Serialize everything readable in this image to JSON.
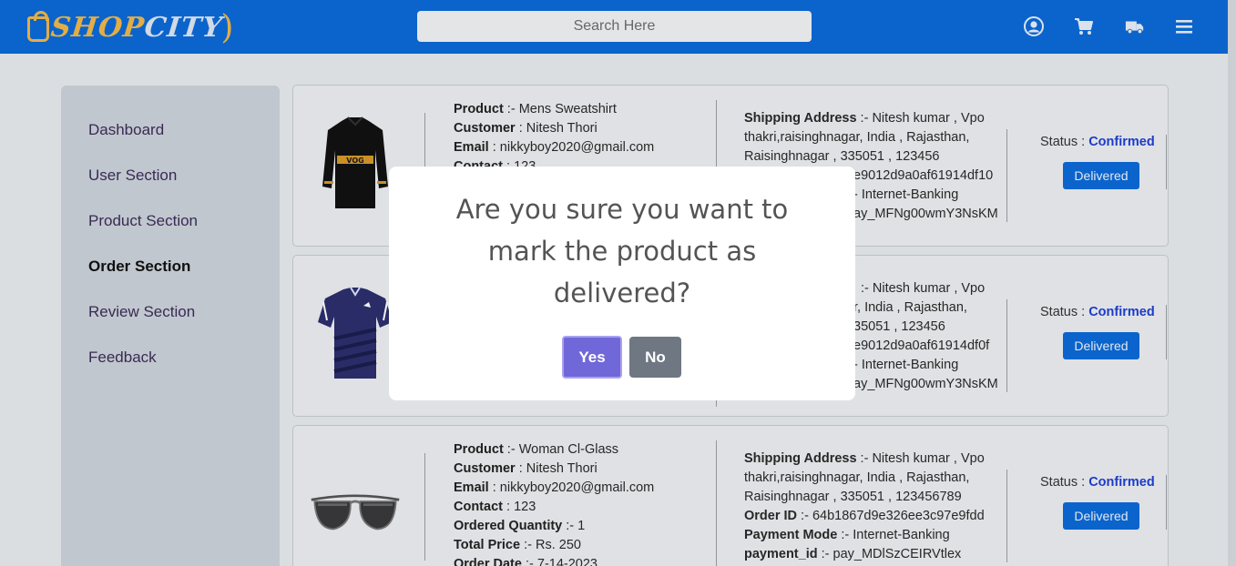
{
  "navbar": {
    "logo_text_1": "SHOP",
    "logo_text_2": "CITY",
    "search_placeholder": "Search Here",
    "icons": [
      "user-icon",
      "cart-icon",
      "truck-icon",
      "menu-icon"
    ],
    "bg_color": "#0b6bd9"
  },
  "sidebar": {
    "items": [
      {
        "label": "Dashboard"
      },
      {
        "label": "User Section"
      },
      {
        "label": "Product Section"
      },
      {
        "label": "Order Section"
      },
      {
        "label": "Review Section"
      },
      {
        "label": "Feedback"
      }
    ],
    "active": "Order Section"
  },
  "orders": [
    {
      "image": "sweatshirt-icon",
      "lines": [
        {
          "key": "Product",
          "sep": " :- ",
          "val": "Mens Sweatshirt"
        },
        {
          "key": "Customer",
          "sep": "  : ",
          "val": "Nitesh Thori"
        },
        {
          "key": "Email",
          "sep": "  : ",
          "val": "nikkyboy2020@gmail.com"
        },
        {
          "key": "Contact",
          "sep": "  : ",
          "val": "123"
        }
      ],
      "ship_lines": [
        {
          "key": "Shipping Address",
          "sep": "  :- ",
          "val": "Nitesh kumar , Vpo"
        },
        {
          "key": "",
          "sep": "",
          "val": "thakri,raisinghnagar, India , Rajasthan,"
        },
        {
          "key": "",
          "sep": "",
          "val": "Raisinghnagar , 335051 , 123456"
        },
        {
          "key": "",
          "sep": "",
          "val": "e9012d9a0af61914df10"
        },
        {
          "key": "",
          "sep": "",
          "val": "- Internet-Banking"
        },
        {
          "key": "",
          "sep": "",
          "val": "ay_MFNg00wmY3NsKM"
        }
      ],
      "status_label": "Status : ",
      "status_value": "Confirmed",
      "button": "Delivered"
    },
    {
      "image": "tshirt-icon",
      "lines": [],
      "ship_lines": [
        {
          "key": "",
          "sep": "",
          "val": ":- Nitesh kumar , Vpo"
        },
        {
          "key": "",
          "sep": "",
          "val": "r, India , Rajasthan,"
        },
        {
          "key": "",
          "sep": "",
          "val": "35051 , 123456"
        },
        {
          "key": "",
          "sep": "",
          "val": "e9012d9a0af61914df0f"
        },
        {
          "key": "",
          "sep": "",
          "val": "- Internet-Banking"
        },
        {
          "key": "",
          "sep": "",
          "val": "ay_MFNg00wmY3NsKM"
        }
      ],
      "status_label": "Status : ",
      "status_value": "Confirmed",
      "button": "Delivered"
    },
    {
      "image": "sunglasses-icon",
      "lines": [
        {
          "key": "Product",
          "sep": " :- ",
          "val": "Woman Cl-Glass"
        },
        {
          "key": "Customer",
          "sep": "  : ",
          "val": "Nitesh Thori"
        },
        {
          "key": "Email",
          "sep": "  : ",
          "val": "nikkyboy2020@gmail.com"
        },
        {
          "key": "Contact",
          "sep": "  : ",
          "val": "123"
        },
        {
          "key": "Ordered Quantity",
          "sep": "  :- ",
          "val": "1"
        },
        {
          "key": "Total Price",
          "sep": "  :- ",
          "val": "Rs. 250"
        },
        {
          "key": "Order Date",
          "sep": "  :- ",
          "val": "7-14-2023"
        }
      ],
      "ship_lines": [
        {
          "key": "Shipping Address",
          "sep": "  :- ",
          "val": "Nitesh kumar , Vpo"
        },
        {
          "key": "",
          "sep": "",
          "val": "thakri,raisinghnagar, India , Rajasthan,"
        },
        {
          "key": "",
          "sep": "",
          "val": "Raisinghnagar , 335051 , 123456789"
        },
        {
          "key": "Order ID",
          "sep": "  :- ",
          "val": "64b1867d9e326ee3c97e9fdd"
        },
        {
          "key": "Payment Mode",
          "sep": "  :- ",
          "val": "Internet-Banking"
        },
        {
          "key": "payment_id",
          "sep": "  :- ",
          "val": "pay_MDlSzCEIRVtlex"
        }
      ],
      "status_label": "Status : ",
      "status_value": "Confirmed",
      "button": "Delivered"
    }
  ],
  "modal": {
    "message": "Are you sure you want to mark the product as delivered?",
    "yes_label": "Yes",
    "no_label": "No"
  }
}
